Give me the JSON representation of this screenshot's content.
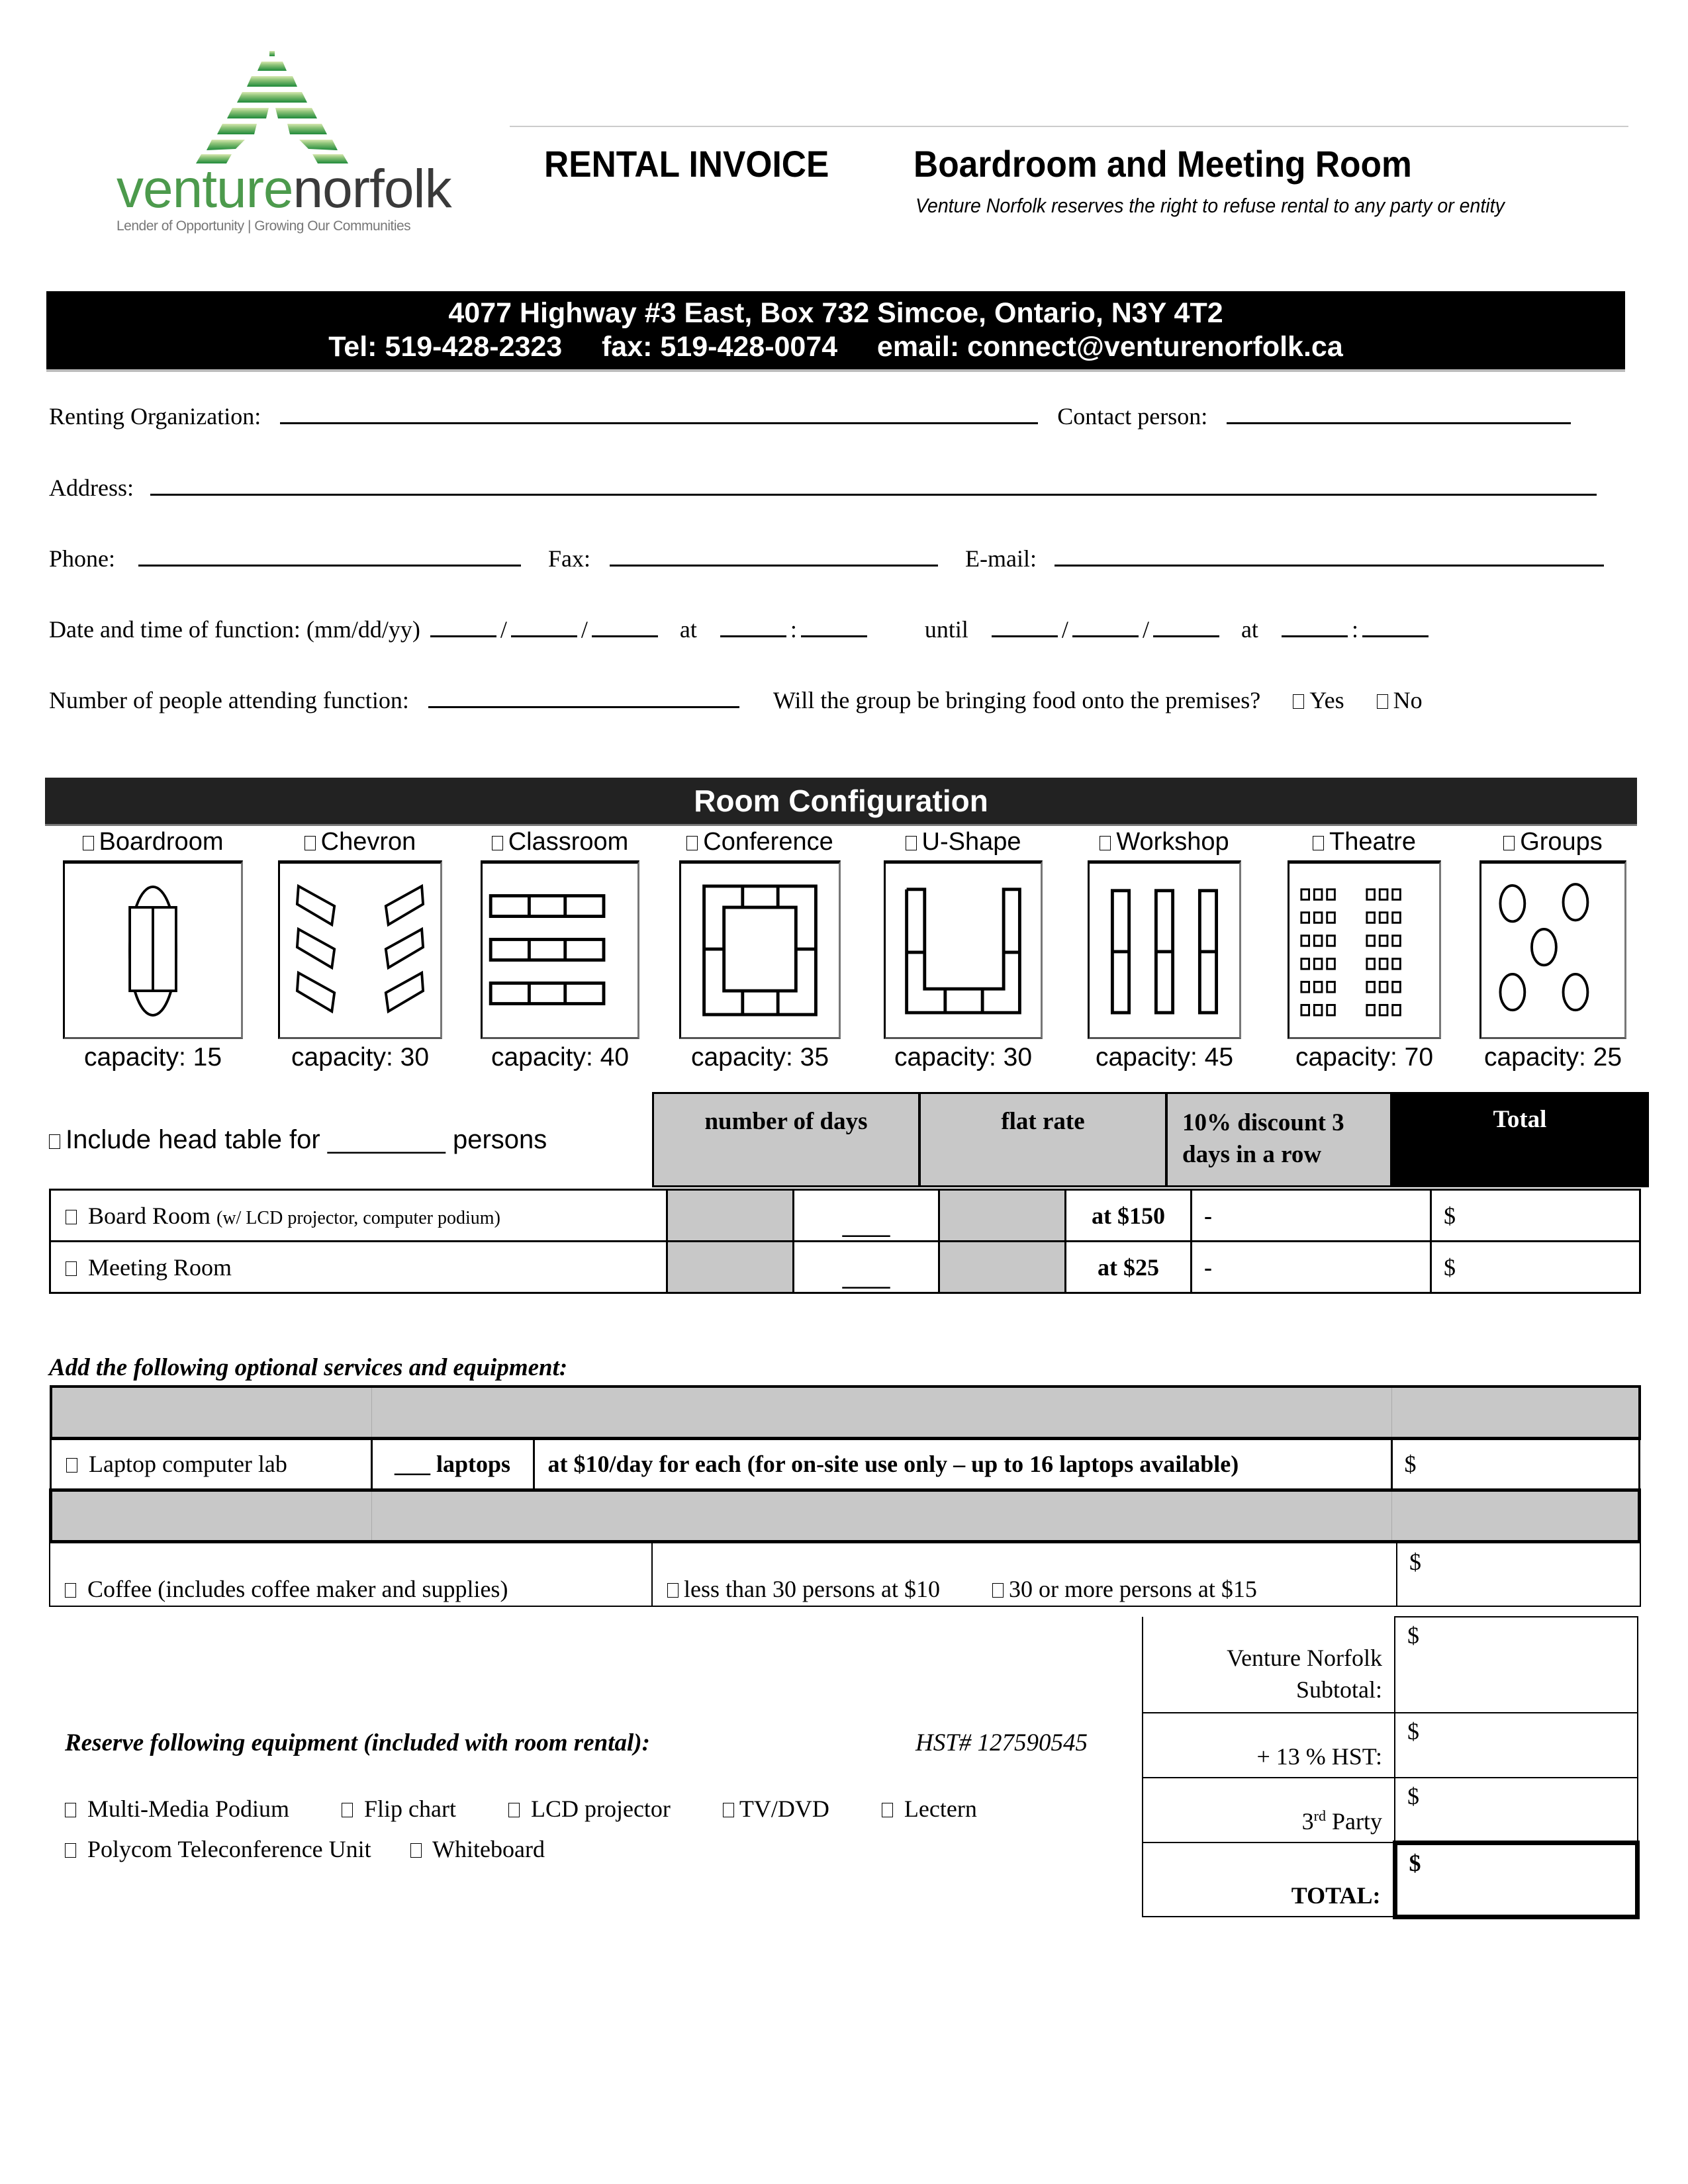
{
  "logo": {
    "brand_part1": "venture",
    "brand_part2": "norfolk",
    "tagline": "Lender of Opportunity  |  Growing Our Communities",
    "colors": {
      "green_dark": "#1f8a3a",
      "green_light": "#a9d18e",
      "text_green": "#4c9a4c",
      "text_gray": "#3a3a3a"
    }
  },
  "header": {
    "title_left": "RENTAL INVOICE",
    "title_right": "Boardroom and Meeting Room",
    "disclaimer": "Venture Norfolk reserves the right to refuse rental to any party or entity"
  },
  "contact": {
    "address": "4077 Highway #3 East, Box 732 Simcoe, Ontario, N3Y 4T2",
    "tel": "Tel: 519-428-2323",
    "fax": "fax: 519-428-0074",
    "email": "email: connect@venturenorfolk.ca"
  },
  "form": {
    "renting_org_label": "Renting Organization:",
    "contact_person_label": "Contact person:",
    "address_label": "Address:",
    "phone_label": "Phone:",
    "fax_label": "Fax:",
    "email_label": "E-mail:",
    "date_label": "Date and time of function:  (mm/dd/yy)",
    "at_label": "at",
    "until_label": "until",
    "attending_label": "Number of people attending function:",
    "food_question": "Will the group be bringing food onto the premises?",
    "yes_label": "Yes",
    "no_label": "No"
  },
  "room_config": {
    "title": "Room Configuration",
    "layouts": [
      {
        "label": "Boardroom",
        "capacity": "capacity: 15",
        "icon": "boardroom-layout-icon"
      },
      {
        "label": "Chevron",
        "capacity": "capacity: 30",
        "icon": "chevron-layout-icon"
      },
      {
        "label": "Classroom",
        "capacity": "capacity: 40",
        "icon": "classroom-layout-icon"
      },
      {
        "label": "Conference",
        "capacity": "capacity: 35",
        "icon": "conference-layout-icon"
      },
      {
        "label": "U-Shape",
        "capacity": "capacity: 30",
        "icon": "u-shape-layout-icon"
      },
      {
        "label": "Workshop",
        "capacity": "capacity: 45",
        "icon": "workshop-layout-icon"
      },
      {
        "label": "Theatre",
        "capacity": "capacity: 70",
        "icon": "theatre-layout-icon"
      },
      {
        "label": "Groups",
        "capacity": "capacity: 25",
        "icon": "groups-layout-icon"
      }
    ]
  },
  "rental": {
    "head_table_prefix": "Include head table for",
    "head_table_suffix": "persons",
    "head_table_blank": "________",
    "columns": {
      "days": "number of days",
      "flat_rate": "flat rate",
      "discount": "10% discount  3 days in a row",
      "total": "Total"
    },
    "rows": [
      {
        "name": "Board Room",
        "note": "(w/ LCD projector, computer podium)",
        "days_blank": "____",
        "rate": "at $150",
        "discount": "-",
        "total": "$"
      },
      {
        "name": "Meeting Room",
        "note": "",
        "days_blank": "____",
        "rate": "at $25",
        "discount": "-",
        "total": "$"
      }
    ]
  },
  "services": {
    "title": "Add the following optional services and equipment:",
    "laptop": {
      "label": "Laptop computer lab",
      "qty": "___ laptops",
      "desc": "at $10/day for each  (for on-site use only – up to 16 laptops available)",
      "total": "$"
    },
    "coffee": {
      "label": "Coffee (includes coffee maker and supplies)",
      "option1": "less than 30 persons at $10",
      "option2": "30 or more persons at $15",
      "total": "$"
    }
  },
  "equipment": {
    "title": "Reserve following equipment (included with room rental):",
    "hst_number": "HST# 127590545",
    "items_row1": [
      "Multi-Media Podium",
      "Flip chart",
      "LCD projector",
      "TV/DVD",
      "Lectern"
    ],
    "items_row2": [
      "Polycom Teleconference Unit",
      "Whiteboard"
    ]
  },
  "summary": {
    "subtotal_label_1": "Venture Norfolk",
    "subtotal_label_2": "Subtotal:",
    "hst_label": "+ 13 %  HST:",
    "third_party_num": "3",
    "third_party_sup": "rd",
    "third_party_label": " Party",
    "total_label": "TOTAL:",
    "dollar": "$"
  }
}
